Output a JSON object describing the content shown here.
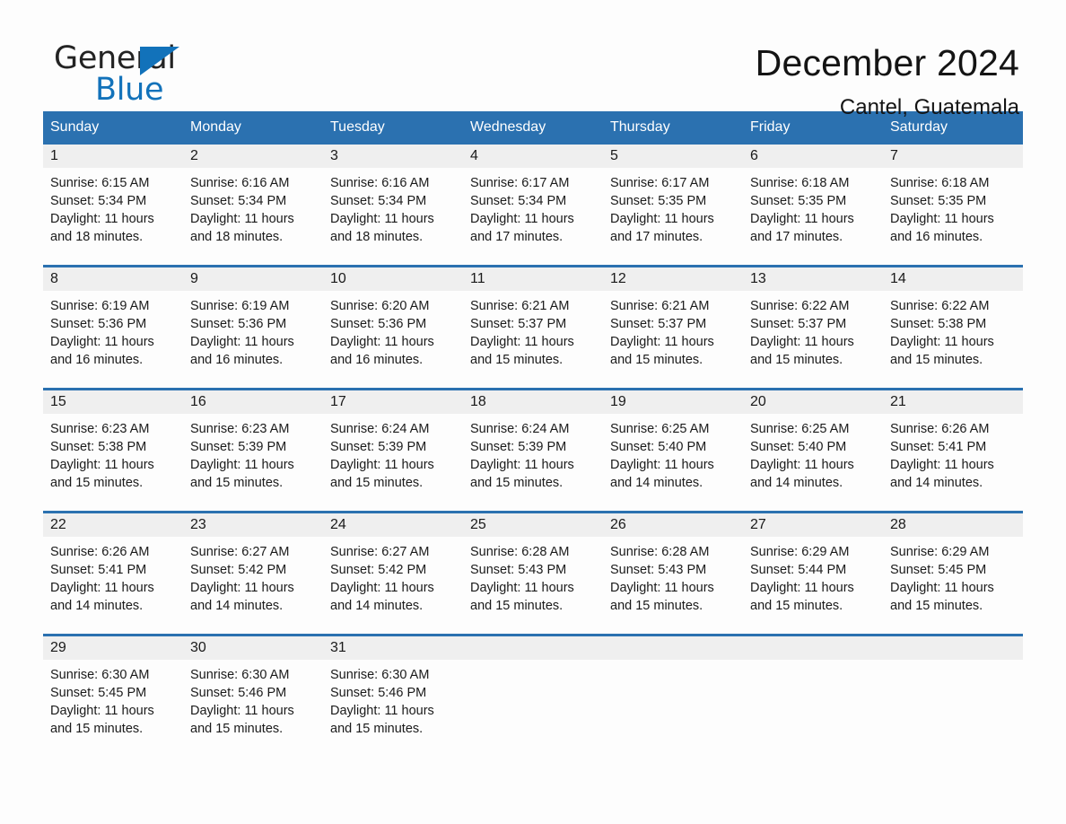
{
  "brand": {
    "name_top": "General",
    "name_bottom": "Blue",
    "triangle_icon": "triangle-icon",
    "accent_color": "#1272ba"
  },
  "header": {
    "title": "December 2024",
    "subtitle": "Cantel, Guatemala"
  },
  "colors": {
    "header_blue": "#2b71b0",
    "day_band_gray": "#efefef",
    "page_bg": "#fdfdfd",
    "text": "#1a1a1a"
  },
  "weekdays": [
    "Sunday",
    "Monday",
    "Tuesday",
    "Wednesday",
    "Thursday",
    "Friday",
    "Saturday"
  ],
  "weeks": [
    [
      {
        "day": "1",
        "sunrise": "Sunrise: 6:15 AM",
        "sunset": "Sunset: 5:34 PM",
        "daylight": "Daylight: 11 hours and 18 minutes."
      },
      {
        "day": "2",
        "sunrise": "Sunrise: 6:16 AM",
        "sunset": "Sunset: 5:34 PM",
        "daylight": "Daylight: 11 hours and 18 minutes."
      },
      {
        "day": "3",
        "sunrise": "Sunrise: 6:16 AM",
        "sunset": "Sunset: 5:34 PM",
        "daylight": "Daylight: 11 hours and 18 minutes."
      },
      {
        "day": "4",
        "sunrise": "Sunrise: 6:17 AM",
        "sunset": "Sunset: 5:34 PM",
        "daylight": "Daylight: 11 hours and 17 minutes."
      },
      {
        "day": "5",
        "sunrise": "Sunrise: 6:17 AM",
        "sunset": "Sunset: 5:35 PM",
        "daylight": "Daylight: 11 hours and 17 minutes."
      },
      {
        "day": "6",
        "sunrise": "Sunrise: 6:18 AM",
        "sunset": "Sunset: 5:35 PM",
        "daylight": "Daylight: 11 hours and 17 minutes."
      },
      {
        "day": "7",
        "sunrise": "Sunrise: 6:18 AM",
        "sunset": "Sunset: 5:35 PM",
        "daylight": "Daylight: 11 hours and 16 minutes."
      }
    ],
    [
      {
        "day": "8",
        "sunrise": "Sunrise: 6:19 AM",
        "sunset": "Sunset: 5:36 PM",
        "daylight": "Daylight: 11 hours and 16 minutes."
      },
      {
        "day": "9",
        "sunrise": "Sunrise: 6:19 AM",
        "sunset": "Sunset: 5:36 PM",
        "daylight": "Daylight: 11 hours and 16 minutes."
      },
      {
        "day": "10",
        "sunrise": "Sunrise: 6:20 AM",
        "sunset": "Sunset: 5:36 PM",
        "daylight": "Daylight: 11 hours and 16 minutes."
      },
      {
        "day": "11",
        "sunrise": "Sunrise: 6:21 AM",
        "sunset": "Sunset: 5:37 PM",
        "daylight": "Daylight: 11 hours and 15 minutes."
      },
      {
        "day": "12",
        "sunrise": "Sunrise: 6:21 AM",
        "sunset": "Sunset: 5:37 PM",
        "daylight": "Daylight: 11 hours and 15 minutes."
      },
      {
        "day": "13",
        "sunrise": "Sunrise: 6:22 AM",
        "sunset": "Sunset: 5:37 PM",
        "daylight": "Daylight: 11 hours and 15 minutes."
      },
      {
        "day": "14",
        "sunrise": "Sunrise: 6:22 AM",
        "sunset": "Sunset: 5:38 PM",
        "daylight": "Daylight: 11 hours and 15 minutes."
      }
    ],
    [
      {
        "day": "15",
        "sunrise": "Sunrise: 6:23 AM",
        "sunset": "Sunset: 5:38 PM",
        "daylight": "Daylight: 11 hours and 15 minutes."
      },
      {
        "day": "16",
        "sunrise": "Sunrise: 6:23 AM",
        "sunset": "Sunset: 5:39 PM",
        "daylight": "Daylight: 11 hours and 15 minutes."
      },
      {
        "day": "17",
        "sunrise": "Sunrise: 6:24 AM",
        "sunset": "Sunset: 5:39 PM",
        "daylight": "Daylight: 11 hours and 15 minutes."
      },
      {
        "day": "18",
        "sunrise": "Sunrise: 6:24 AM",
        "sunset": "Sunset: 5:39 PM",
        "daylight": "Daylight: 11 hours and 15 minutes."
      },
      {
        "day": "19",
        "sunrise": "Sunrise: 6:25 AM",
        "sunset": "Sunset: 5:40 PM",
        "daylight": "Daylight: 11 hours and 14 minutes."
      },
      {
        "day": "20",
        "sunrise": "Sunrise: 6:25 AM",
        "sunset": "Sunset: 5:40 PM",
        "daylight": "Daylight: 11 hours and 14 minutes."
      },
      {
        "day": "21",
        "sunrise": "Sunrise: 6:26 AM",
        "sunset": "Sunset: 5:41 PM",
        "daylight": "Daylight: 11 hours and 14 minutes."
      }
    ],
    [
      {
        "day": "22",
        "sunrise": "Sunrise: 6:26 AM",
        "sunset": "Sunset: 5:41 PM",
        "daylight": "Daylight: 11 hours and 14 minutes."
      },
      {
        "day": "23",
        "sunrise": "Sunrise: 6:27 AM",
        "sunset": "Sunset: 5:42 PM",
        "daylight": "Daylight: 11 hours and 14 minutes."
      },
      {
        "day": "24",
        "sunrise": "Sunrise: 6:27 AM",
        "sunset": "Sunset: 5:42 PM",
        "daylight": "Daylight: 11 hours and 14 minutes."
      },
      {
        "day": "25",
        "sunrise": "Sunrise: 6:28 AM",
        "sunset": "Sunset: 5:43 PM",
        "daylight": "Daylight: 11 hours and 15 minutes."
      },
      {
        "day": "26",
        "sunrise": "Sunrise: 6:28 AM",
        "sunset": "Sunset: 5:43 PM",
        "daylight": "Daylight: 11 hours and 15 minutes."
      },
      {
        "day": "27",
        "sunrise": "Sunrise: 6:29 AM",
        "sunset": "Sunset: 5:44 PM",
        "daylight": "Daylight: 11 hours and 15 minutes."
      },
      {
        "day": "28",
        "sunrise": "Sunrise: 6:29 AM",
        "sunset": "Sunset: 5:45 PM",
        "daylight": "Daylight: 11 hours and 15 minutes."
      }
    ],
    [
      {
        "day": "29",
        "sunrise": "Sunrise: 6:30 AM",
        "sunset": "Sunset: 5:45 PM",
        "daylight": "Daylight: 11 hours and 15 minutes."
      },
      {
        "day": "30",
        "sunrise": "Sunrise: 6:30 AM",
        "sunset": "Sunset: 5:46 PM",
        "daylight": "Daylight: 11 hours and 15 minutes."
      },
      {
        "day": "31",
        "sunrise": "Sunrise: 6:30 AM",
        "sunset": "Sunset: 5:46 PM",
        "daylight": "Daylight: 11 hours and 15 minutes."
      },
      {
        "day": "",
        "sunrise": "",
        "sunset": "",
        "daylight": ""
      },
      {
        "day": "",
        "sunrise": "",
        "sunset": "",
        "daylight": ""
      },
      {
        "day": "",
        "sunrise": "",
        "sunset": "",
        "daylight": ""
      },
      {
        "day": "",
        "sunrise": "",
        "sunset": "",
        "daylight": ""
      }
    ]
  ]
}
